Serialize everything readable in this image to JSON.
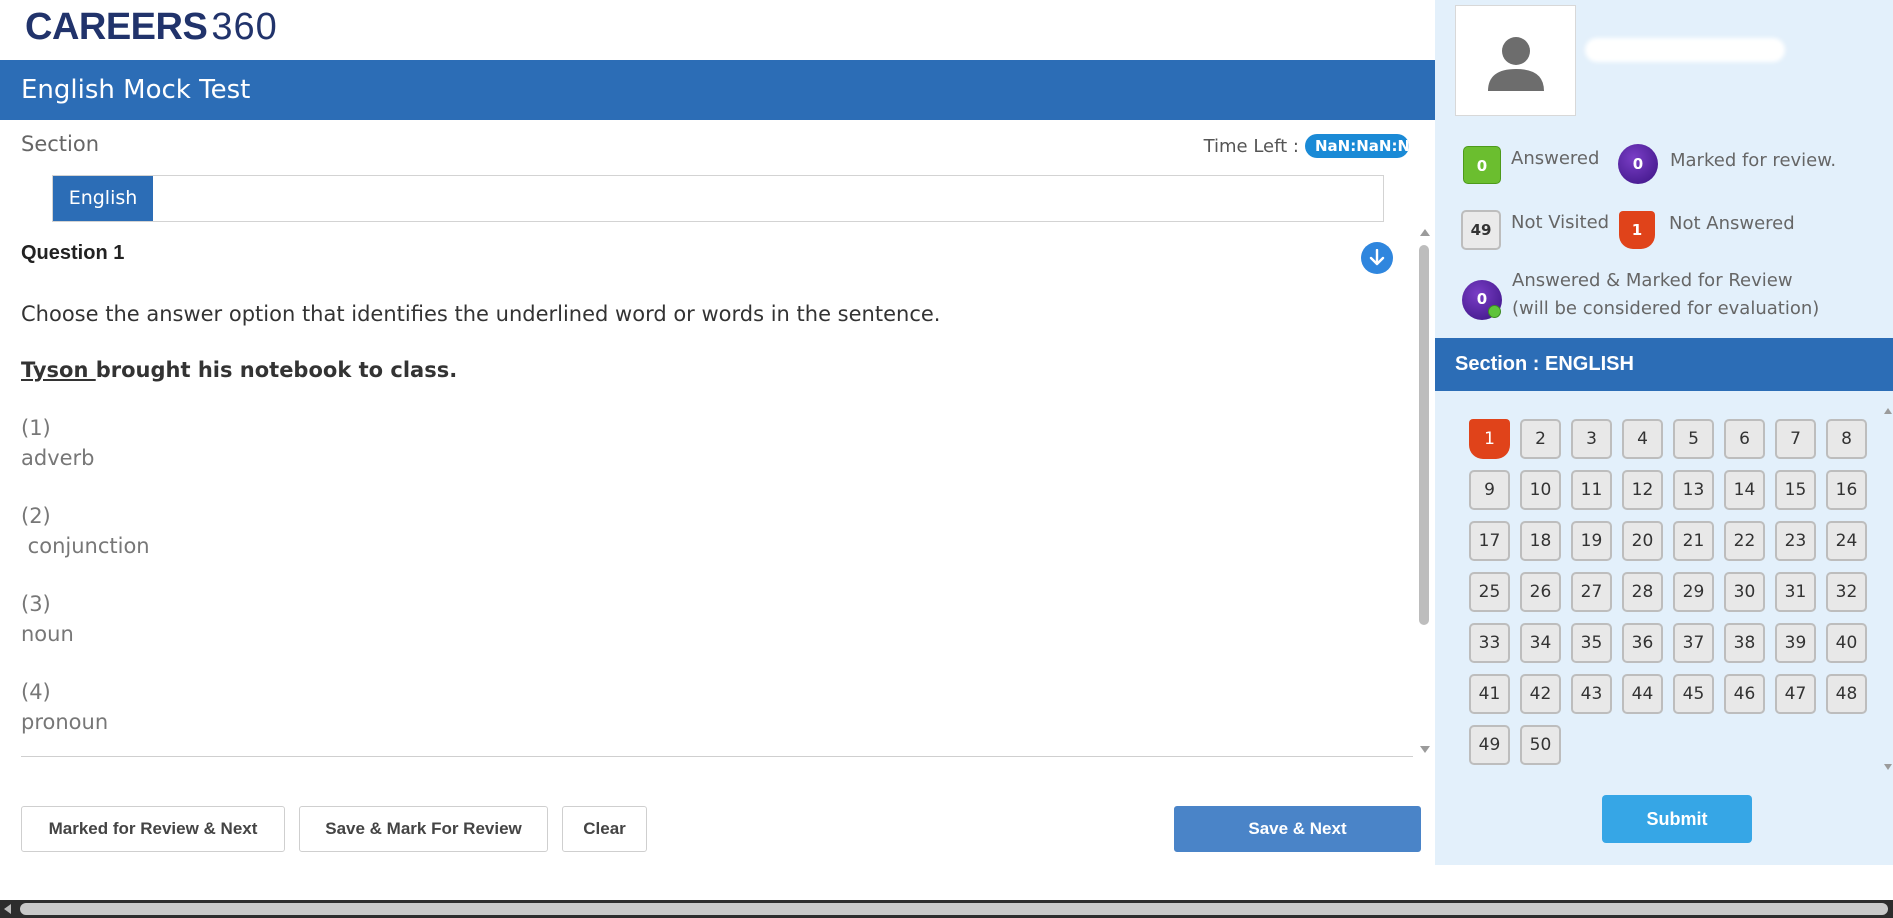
{
  "brand": {
    "logo_bold": "CAREERS",
    "logo_num": "360"
  },
  "test": {
    "title": "English Mock Test"
  },
  "section_label": "Section",
  "timer": {
    "label": "Time Left :",
    "value": "NaN:NaN:N"
  },
  "tabs": [
    {
      "label": "English"
    }
  ],
  "question": {
    "title": "Question 1",
    "text": "Choose the answer option that identifies the underlined word or words in the sentence.",
    "sentence_underlined": "Tyson ",
    "sentence_rest": "brought his notebook to class.",
    "options": [
      {
        "num": "(1)",
        "text": "adverb"
      },
      {
        "num": "(2)",
        "text": " conjunction"
      },
      {
        "num": "(3)",
        "text": "noun"
      },
      {
        "num": "(4)",
        "text": "pronoun"
      }
    ]
  },
  "actions": {
    "marked_review_next": "Marked for Review & Next",
    "save_mark_review": "Save & Mark For Review",
    "clear": "Clear",
    "save_next": "Save & Next"
  },
  "legend": {
    "answered": {
      "count": "0",
      "label": "Answered"
    },
    "marked": {
      "count": "0",
      "label": "Marked for review."
    },
    "not_visited": {
      "count": "49",
      "label": "Not Visited"
    },
    "not_answered": {
      "count": "1",
      "label": "Not Answered"
    },
    "answered_marked": {
      "count": "0",
      "label_line1": "Answered & Marked for Review",
      "label_line2": "(will be considered for evaluation)"
    }
  },
  "palette": {
    "section_title": "Section : ENGLISH",
    "questions": [
      "1",
      "2",
      "3",
      "4",
      "5",
      "6",
      "7",
      "8",
      "9",
      "10",
      "11",
      "12",
      "13",
      "14",
      "15",
      "16",
      "17",
      "18",
      "19",
      "20",
      "21",
      "22",
      "23",
      "24",
      "25",
      "26",
      "27",
      "28",
      "29",
      "30",
      "31",
      "32",
      "33",
      "34",
      "35",
      "36",
      "37",
      "38",
      "39",
      "40",
      "41",
      "42",
      "43",
      "44",
      "45",
      "46",
      "47",
      "48",
      "49",
      "50"
    ],
    "not_answered": [
      "1"
    ]
  },
  "submit_label": "Submit",
  "colors": {
    "primary": "#2c6db6",
    "answered": "#6bbe2f",
    "marked": "#4a1a98",
    "not_answered": "#e0431a",
    "submit": "#36a6e6",
    "panel_bg": "#e3f0fb"
  },
  "icons": {
    "profile": "user-silhouette-icon",
    "scroll_down": "arrow-down-circle-icon"
  }
}
